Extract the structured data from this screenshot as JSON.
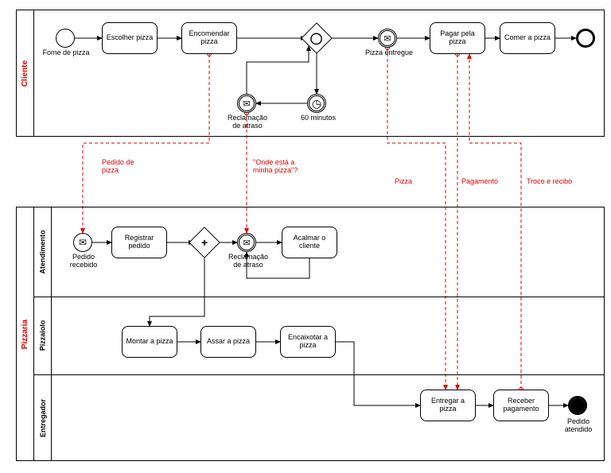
{
  "pools": {
    "cliente": {
      "label": "Cliente",
      "start_event": "Fome de pizza",
      "tasks": {
        "escolher": "Escolher pizza",
        "encomendar": "Encomendar pizza",
        "pagar": "Pagar pela pizza",
        "comer": "Comer a pizza"
      },
      "events": {
        "reclamacao": "Reclamação de atraso",
        "sessenta": "60 minutos",
        "entregue": "Pizza entregue"
      }
    },
    "pizzaria": {
      "label": "Pizzaria",
      "lanes": {
        "atendimento": {
          "label": "Atendimento",
          "start_event": "Pedido recebido",
          "reclamacao_event": "Reclamação de atraso",
          "tasks": {
            "registrar": "Registrar pedido",
            "acalmar": "Acalmar o cliente"
          }
        },
        "pizzaiolo": {
          "label": "Pizzaiolo",
          "tasks": {
            "montar": "Montar a pizza",
            "assar": "Assar a pizza",
            "encaixotar": "Encaixotar a pizza"
          }
        },
        "entregador": {
          "label": "Entregador",
          "tasks": {
            "entregar": "Entregar a pizza",
            "receber": "Receber pagamento"
          },
          "end_event": "Pedido atendido"
        }
      }
    }
  },
  "messages": {
    "pedido": "Pedido de pizza",
    "onde": "\"Onde está a minha pizza\"?",
    "pizza": "Pizza",
    "pagamento": "Pagamento",
    "troco": "Troco e recibo"
  }
}
